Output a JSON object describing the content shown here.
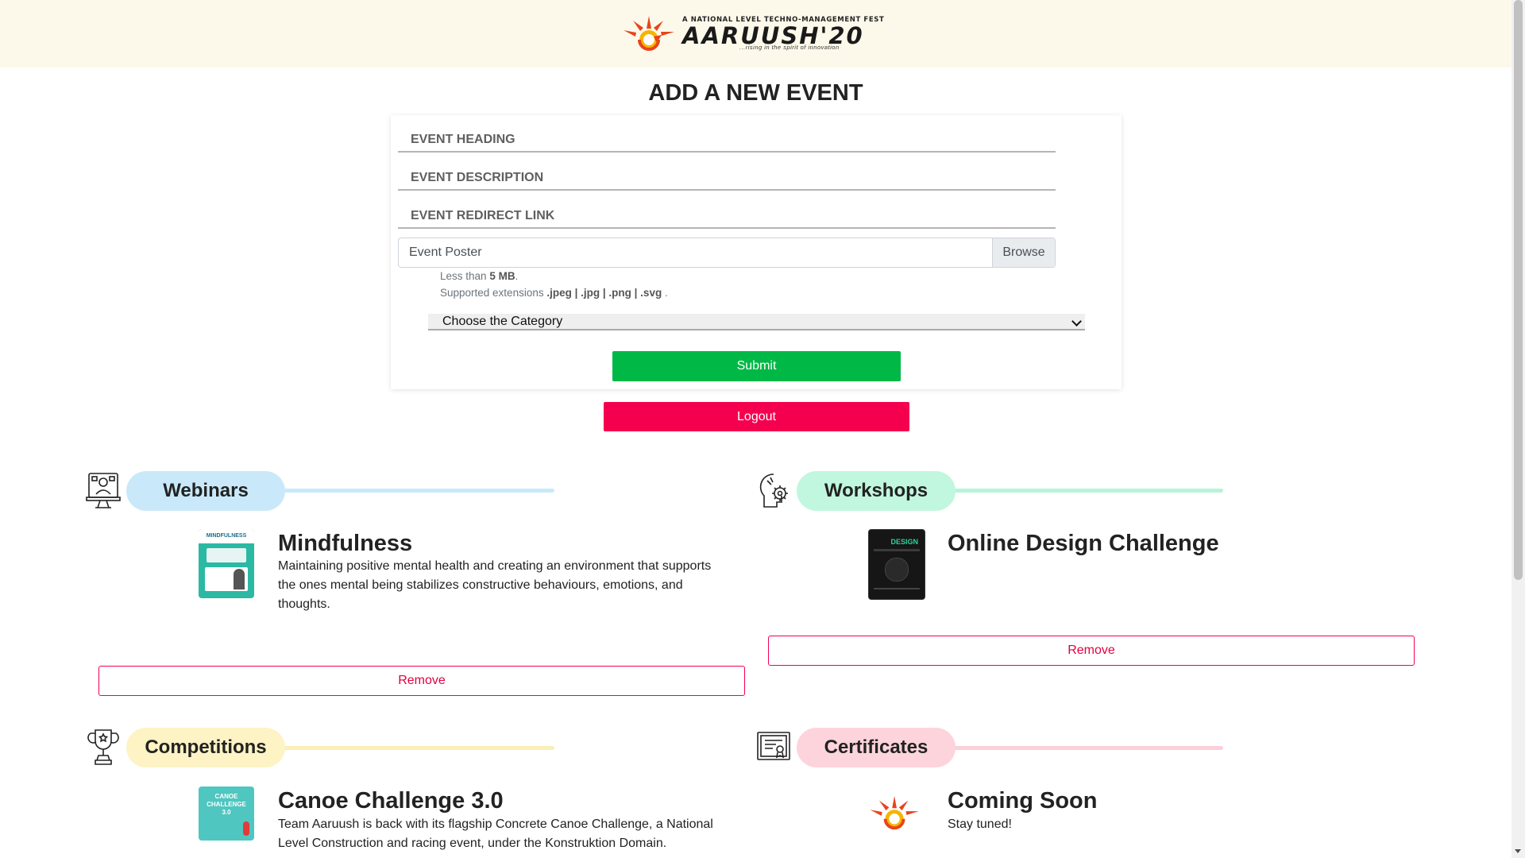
{
  "header": {
    "logo_tagline": "A NATIONAL LEVEL TECHNO-MANAGEMENT FEST",
    "logo_wordmark": "AARUUSH'20",
    "logo_subtitle": "...rising in the spirit of innovation"
  },
  "form": {
    "title": "ADD A NEW EVENT",
    "heading_placeholder": "EVENT HEADING",
    "description_placeholder": "EVENT DESCRIPTION",
    "link_placeholder": "EVENT REDIRECT LINK",
    "poster_label": "Event Poster",
    "browse_label": "Browse",
    "help_size_prefix": "Less than",
    "help_size_value": "5 MB",
    "help_size_suffix": ".",
    "help_ext_prefix": "Supported extensions",
    "help_ext_value": ".jpeg | .jpg | .png | .svg",
    "help_ext_suffix": ".",
    "category_selected": "Choose the Category",
    "submit_label": "Submit",
    "logout_label": "Logout"
  },
  "sections": {
    "webinars": {
      "label": "Webinars",
      "color": "#c9e9fa",
      "line_color": "#c9e9fa",
      "event_title": "Mindfulness",
      "event_desc": "Maintaining positive mental health and creating an environment that supports the ones mental being stabilizes constructive behaviours, emotions, and thoughts.",
      "remove_label": "Remove"
    },
    "workshops": {
      "label": "Workshops",
      "color": "#c1f7de",
      "line_color": "#b6f5d8",
      "event_title": "Online Design Challenge",
      "remove_label": "Remove"
    },
    "competitions": {
      "label": "Competitions",
      "color": "#fdf3c4",
      "line_color": "#fbeeb7",
      "event_title": "Canoe Challenge 3.0",
      "event_desc": "Team Aaruush is back with its flagship Concrete Canoe Challenge, a National Level Construction and racing event, under the Konstruktion Domain."
    },
    "certificates": {
      "label": "Certificates",
      "color": "#fdd4dc",
      "line_color": "#fbd0d9",
      "event_title": "Coming Soon",
      "event_desc": "Stay tuned!"
    }
  },
  "thumbnails": {
    "mindfulness_text": "MINDFULNESS",
    "design_text": "DESIGN",
    "canoe_text": "CANOE CHALLENGE 3.0"
  },
  "colors": {
    "submit": "#00b846",
    "logout": "#f5004f",
    "header_bg": "#fdf9ea"
  }
}
